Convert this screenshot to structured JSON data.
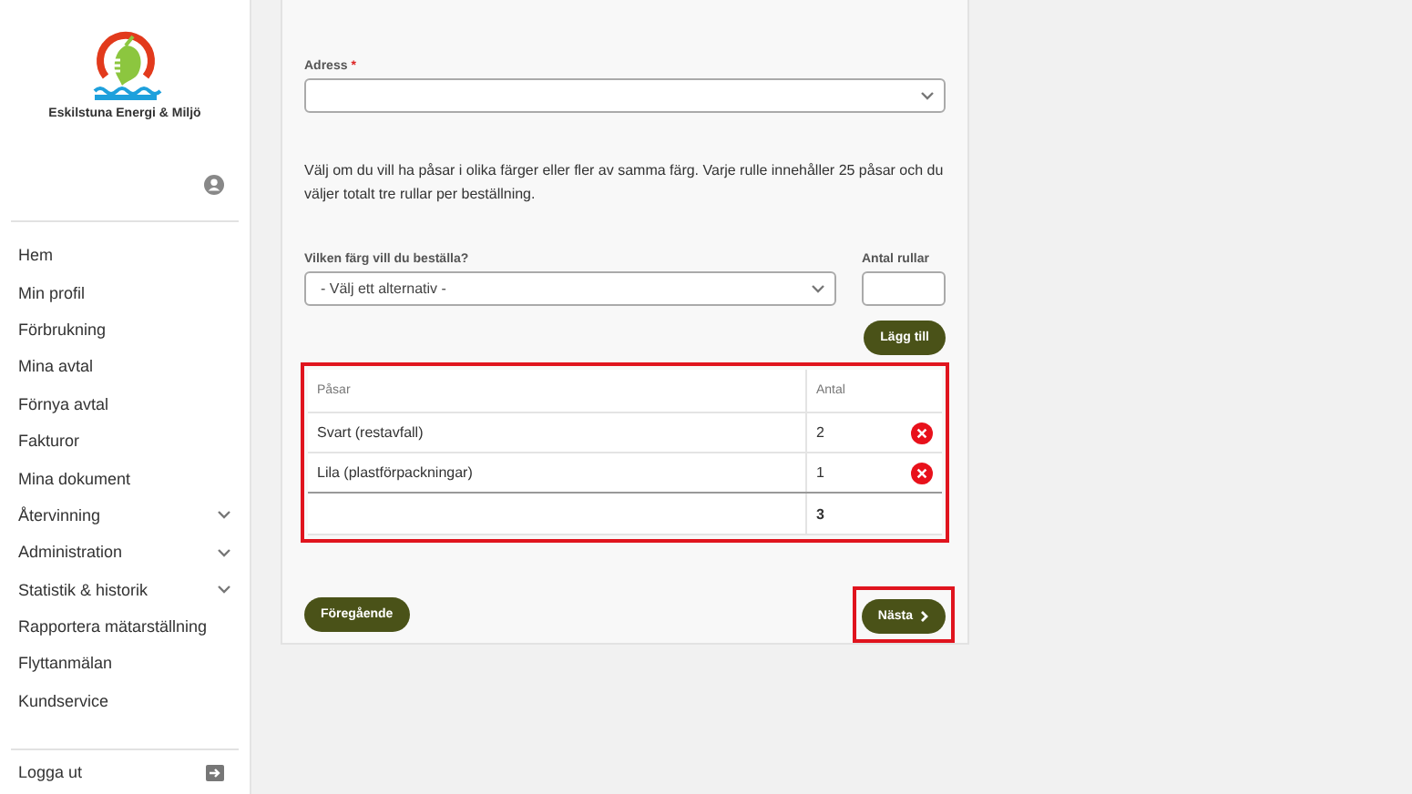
{
  "sidebar": {
    "logo_text": "Eskilstuna Energi & Miljö",
    "items": [
      {
        "label": "Hem",
        "expandable": false
      },
      {
        "label": "Min profil",
        "expandable": false
      },
      {
        "label": "Förbrukning",
        "expandable": false
      },
      {
        "label": "Mina avtal",
        "expandable": false
      },
      {
        "label": "Förnya avtal",
        "expandable": false
      },
      {
        "label": "Fakturor",
        "expandable": false
      },
      {
        "label": "Mina dokument",
        "expandable": false
      },
      {
        "label": "Återvinning",
        "expandable": true
      },
      {
        "label": "Administration",
        "expandable": true
      },
      {
        "label": "Statistik & historik",
        "expandable": true
      },
      {
        "label": "Rapportera mätarställning",
        "expandable": false
      },
      {
        "label": "Flyttanmälan",
        "expandable": false
      },
      {
        "label": "Kundservice",
        "expandable": false
      }
    ],
    "logout": "Logga ut"
  },
  "form": {
    "address": {
      "label": "Adress",
      "required_mark": "*"
    },
    "description": "Välj om du vill ha påsar i olika färger eller fler av samma färg. Varje rulle innehåller 25 påsar och du väljer totalt tre rullar per beställning.",
    "color_select": {
      "label": "Vilken färg vill du beställa?",
      "value": "- Välj ett alternativ -"
    },
    "quantity": {
      "label": "Antal rullar"
    },
    "add_button": "Lägg till",
    "table": {
      "highlighted": true,
      "columns": [
        "Påsar",
        "Antal"
      ],
      "rows": [
        {
          "bag": "Svart (restavfall)",
          "count": "2"
        },
        {
          "bag": "Lila (plastförpackningar)",
          "count": "1"
        }
      ],
      "total": "3"
    },
    "previous_button": "Föregående",
    "next_button": {
      "label": "Nästa",
      "highlighted": true
    }
  }
}
